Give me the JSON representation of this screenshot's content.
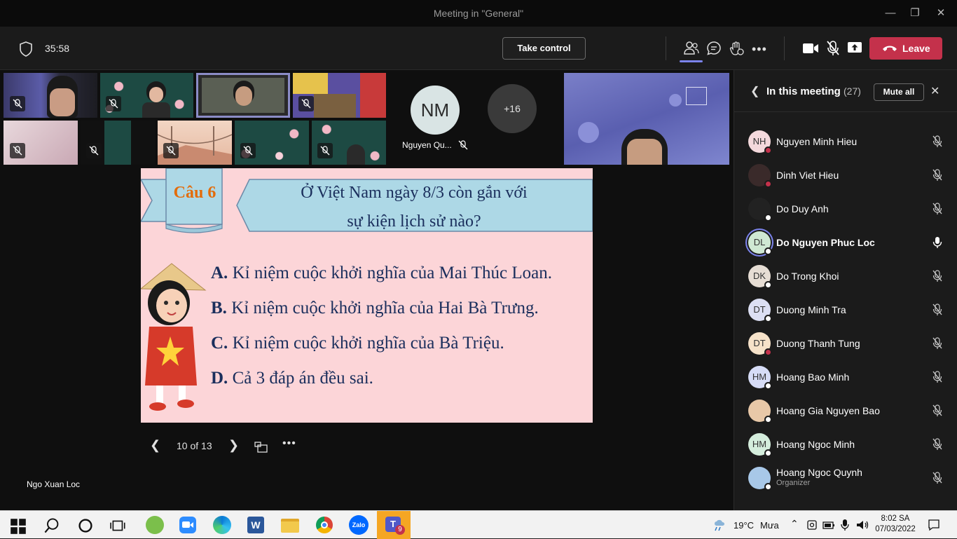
{
  "window": {
    "title": "Meeting in \"General\""
  },
  "toolbar": {
    "timer": "35:58",
    "take_control_label": "Take control",
    "leave_label": "Leave",
    "icons": [
      "shield-icon",
      "people-icon",
      "chat-icon",
      "reactions-icon",
      "more-icon",
      "camera-icon",
      "mic-off-icon",
      "share-icon"
    ]
  },
  "stage": {
    "tiles": {
      "avatar_initials": "NM",
      "avatar_name": "Nguyen Qu...",
      "more_count": "+16"
    },
    "slide": {
      "question_label": "Câu 6",
      "question_line1": "Ở Việt Nam ngày 8/3 còn gắn với",
      "question_line2": "sự kiện lịch sử nào?",
      "answers": [
        {
          "letter": "A.",
          "text": "Kỉ niệm cuộc khởi nghĩa của Mai Thúc Loan."
        },
        {
          "letter": "B.",
          "text": "Kỉ niệm cuộc khởi nghĩa của Hai Bà Trưng."
        },
        {
          "letter": "C.",
          "text": "Kỉ niệm cuộc khởi nghĩa của Bà Triệu."
        },
        {
          "letter": "D.",
          "text": "Cả 3 đáp án đều sai."
        }
      ]
    },
    "slide_nav": {
      "page": "10 of 13"
    },
    "presenter_name": "Ngo Xuan Loc"
  },
  "panel": {
    "title": "In this meeting",
    "count": "(27)",
    "mute_all_label": "Mute all",
    "participants": [
      {
        "initials": "NH",
        "name": "Nguyen Minh Hieu",
        "avatar_bg": "#f4d9dc",
        "status": "#c4314b",
        "mic": "off"
      },
      {
        "initials": "",
        "name": "Dinh Viet Hieu",
        "avatar_bg": "#3a2a2a",
        "status": "#c4314b",
        "mic": "off"
      },
      {
        "initials": "",
        "name": "Do Duy Anh",
        "avatar_bg": "#222222",
        "status": "#ffffff",
        "mic": "off"
      },
      {
        "initials": "DL",
        "name": "Do Nguyen Phuc Loc",
        "avatar_bg": "#cfe8d3",
        "status": "#ffffff",
        "mic": "on",
        "speaking": true
      },
      {
        "initials": "DK",
        "name": "Do Trong Khoi",
        "avatar_bg": "#e6ddd4",
        "status": "#ffffff",
        "mic": "off"
      },
      {
        "initials": "DT",
        "name": "Duong Minh Tra",
        "avatar_bg": "#dcdff3",
        "status": "#ffffff",
        "mic": "off"
      },
      {
        "initials": "DT",
        "name": "Duong Thanh Tung",
        "avatar_bg": "#f6e2c9",
        "status": "#c4314b",
        "mic": "off"
      },
      {
        "initials": "HM",
        "name": "Hoang Bao Minh",
        "avatar_bg": "#d6dcf6",
        "status": "#ffffff",
        "mic": "off"
      },
      {
        "initials": "",
        "name": "Hoang Gia Nguyen Bao",
        "avatar_bg": "#e8c8a8",
        "status": "#ffffff",
        "mic": "off"
      },
      {
        "initials": "HM",
        "name": "Hoang Ngoc Minh",
        "avatar_bg": "#d4eddc",
        "status": "#ffffff",
        "mic": "off"
      },
      {
        "initials": "",
        "name": "Hoang Ngoc Quynh",
        "role": "Organizer",
        "avatar_bg": "#a8c8e8",
        "status": "#ffffff",
        "mic": "off"
      }
    ]
  },
  "taskbar": {
    "weather_temp": "19°C",
    "weather_text": "Mưa",
    "time": "8:02 SA",
    "date": "07/03/2022",
    "teams_badge": "9",
    "apps": [
      "windows-start-icon",
      "search-icon",
      "cortana-icon",
      "task-view-icon",
      "app-green-icon",
      "zoom-icon",
      "edge-icon",
      "word-icon",
      "file-explorer-icon",
      "chrome-icon",
      "zalo-icon",
      "teams-icon"
    ]
  }
}
